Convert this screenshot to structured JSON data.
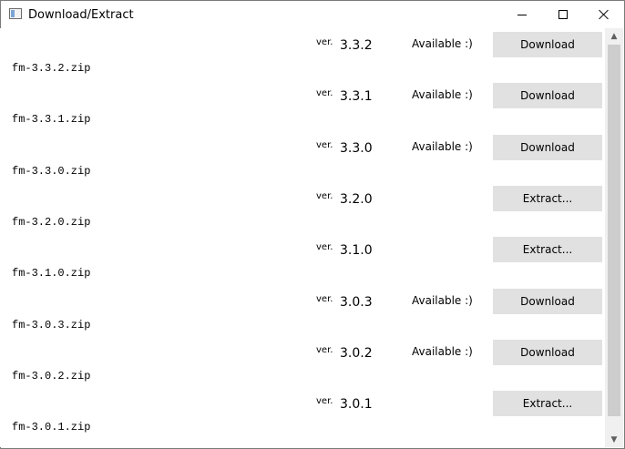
{
  "window": {
    "title": "Download/Extract",
    "app_icon": "window-app-icon",
    "controls": {
      "minimize": "minimize-icon",
      "maximize": "maximize-icon",
      "close": "close-icon"
    }
  },
  "ver_label": "ver.",
  "rows": [
    {
      "version": "3.3.2",
      "status": "Available :)",
      "action": "Download",
      "filename": "fm-3.3.2.zip"
    },
    {
      "version": "3.3.1",
      "status": "Available :)",
      "action": "Download",
      "filename": "fm-3.3.1.zip"
    },
    {
      "version": "3.3.0",
      "status": "Available :)",
      "action": "Download",
      "filename": "fm-3.3.0.zip"
    },
    {
      "version": "3.2.0",
      "status": "",
      "action": "Extract...",
      "filename": "fm-3.2.0.zip"
    },
    {
      "version": "3.1.0",
      "status": "",
      "action": "Extract...",
      "filename": "fm-3.1.0.zip"
    },
    {
      "version": "3.0.3",
      "status": "Available :)",
      "action": "Download",
      "filename": "fm-3.0.3.zip"
    },
    {
      "version": "3.0.2",
      "status": "Available :)",
      "action": "Download",
      "filename": "fm-3.0.2.zip"
    },
    {
      "version": "3.0.1",
      "status": "",
      "action": "Extract...",
      "filename": "fm-3.0.1.zip"
    }
  ],
  "scrollbar": {
    "up_icon": "scroll-up-arrow-icon",
    "down_icon": "scroll-down-arrow-icon"
  }
}
